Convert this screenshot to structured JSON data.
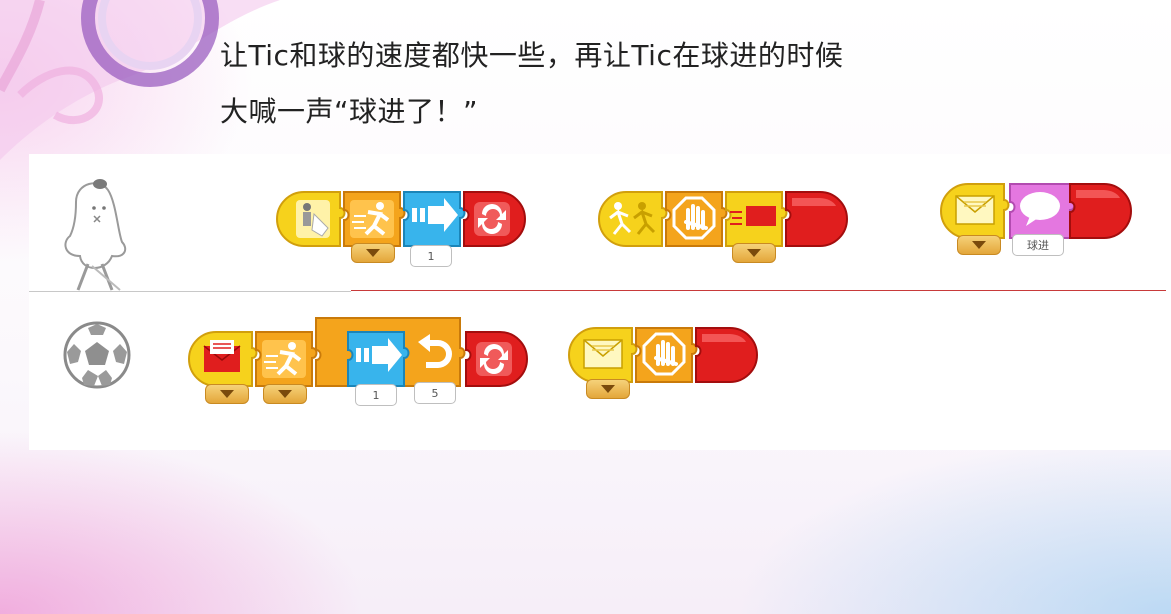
{
  "slide": {
    "title_line1": "让Tic和球的速度都快一些，再让Tic在球进的时候",
    "title_line2": "大喊一声“球进了！”"
  },
  "row1": {
    "script1": {
      "speed_param": "1"
    },
    "script3": {
      "speech_param": "球进"
    }
  },
  "row2": {
    "script1": {
      "speed_param": "1",
      "repeat_param": "5"
    }
  },
  "colors": {
    "yellow": "#f6d21c",
    "orange": "#f4a41c",
    "blue": "#38b4ec",
    "red": "#e01e1e",
    "pink": "#e477e0",
    "divider": "#c83a3a"
  },
  "icons": [
    "tap-start-icon",
    "run-icon",
    "move-right-icon",
    "repeat-forever-icon",
    "bump-start-icon",
    "stop-icon",
    "send-message-icon",
    "receive-message-icon",
    "say-icon",
    "repeat-icon",
    "soccer-ball-icon",
    "tic-character-icon"
  ]
}
